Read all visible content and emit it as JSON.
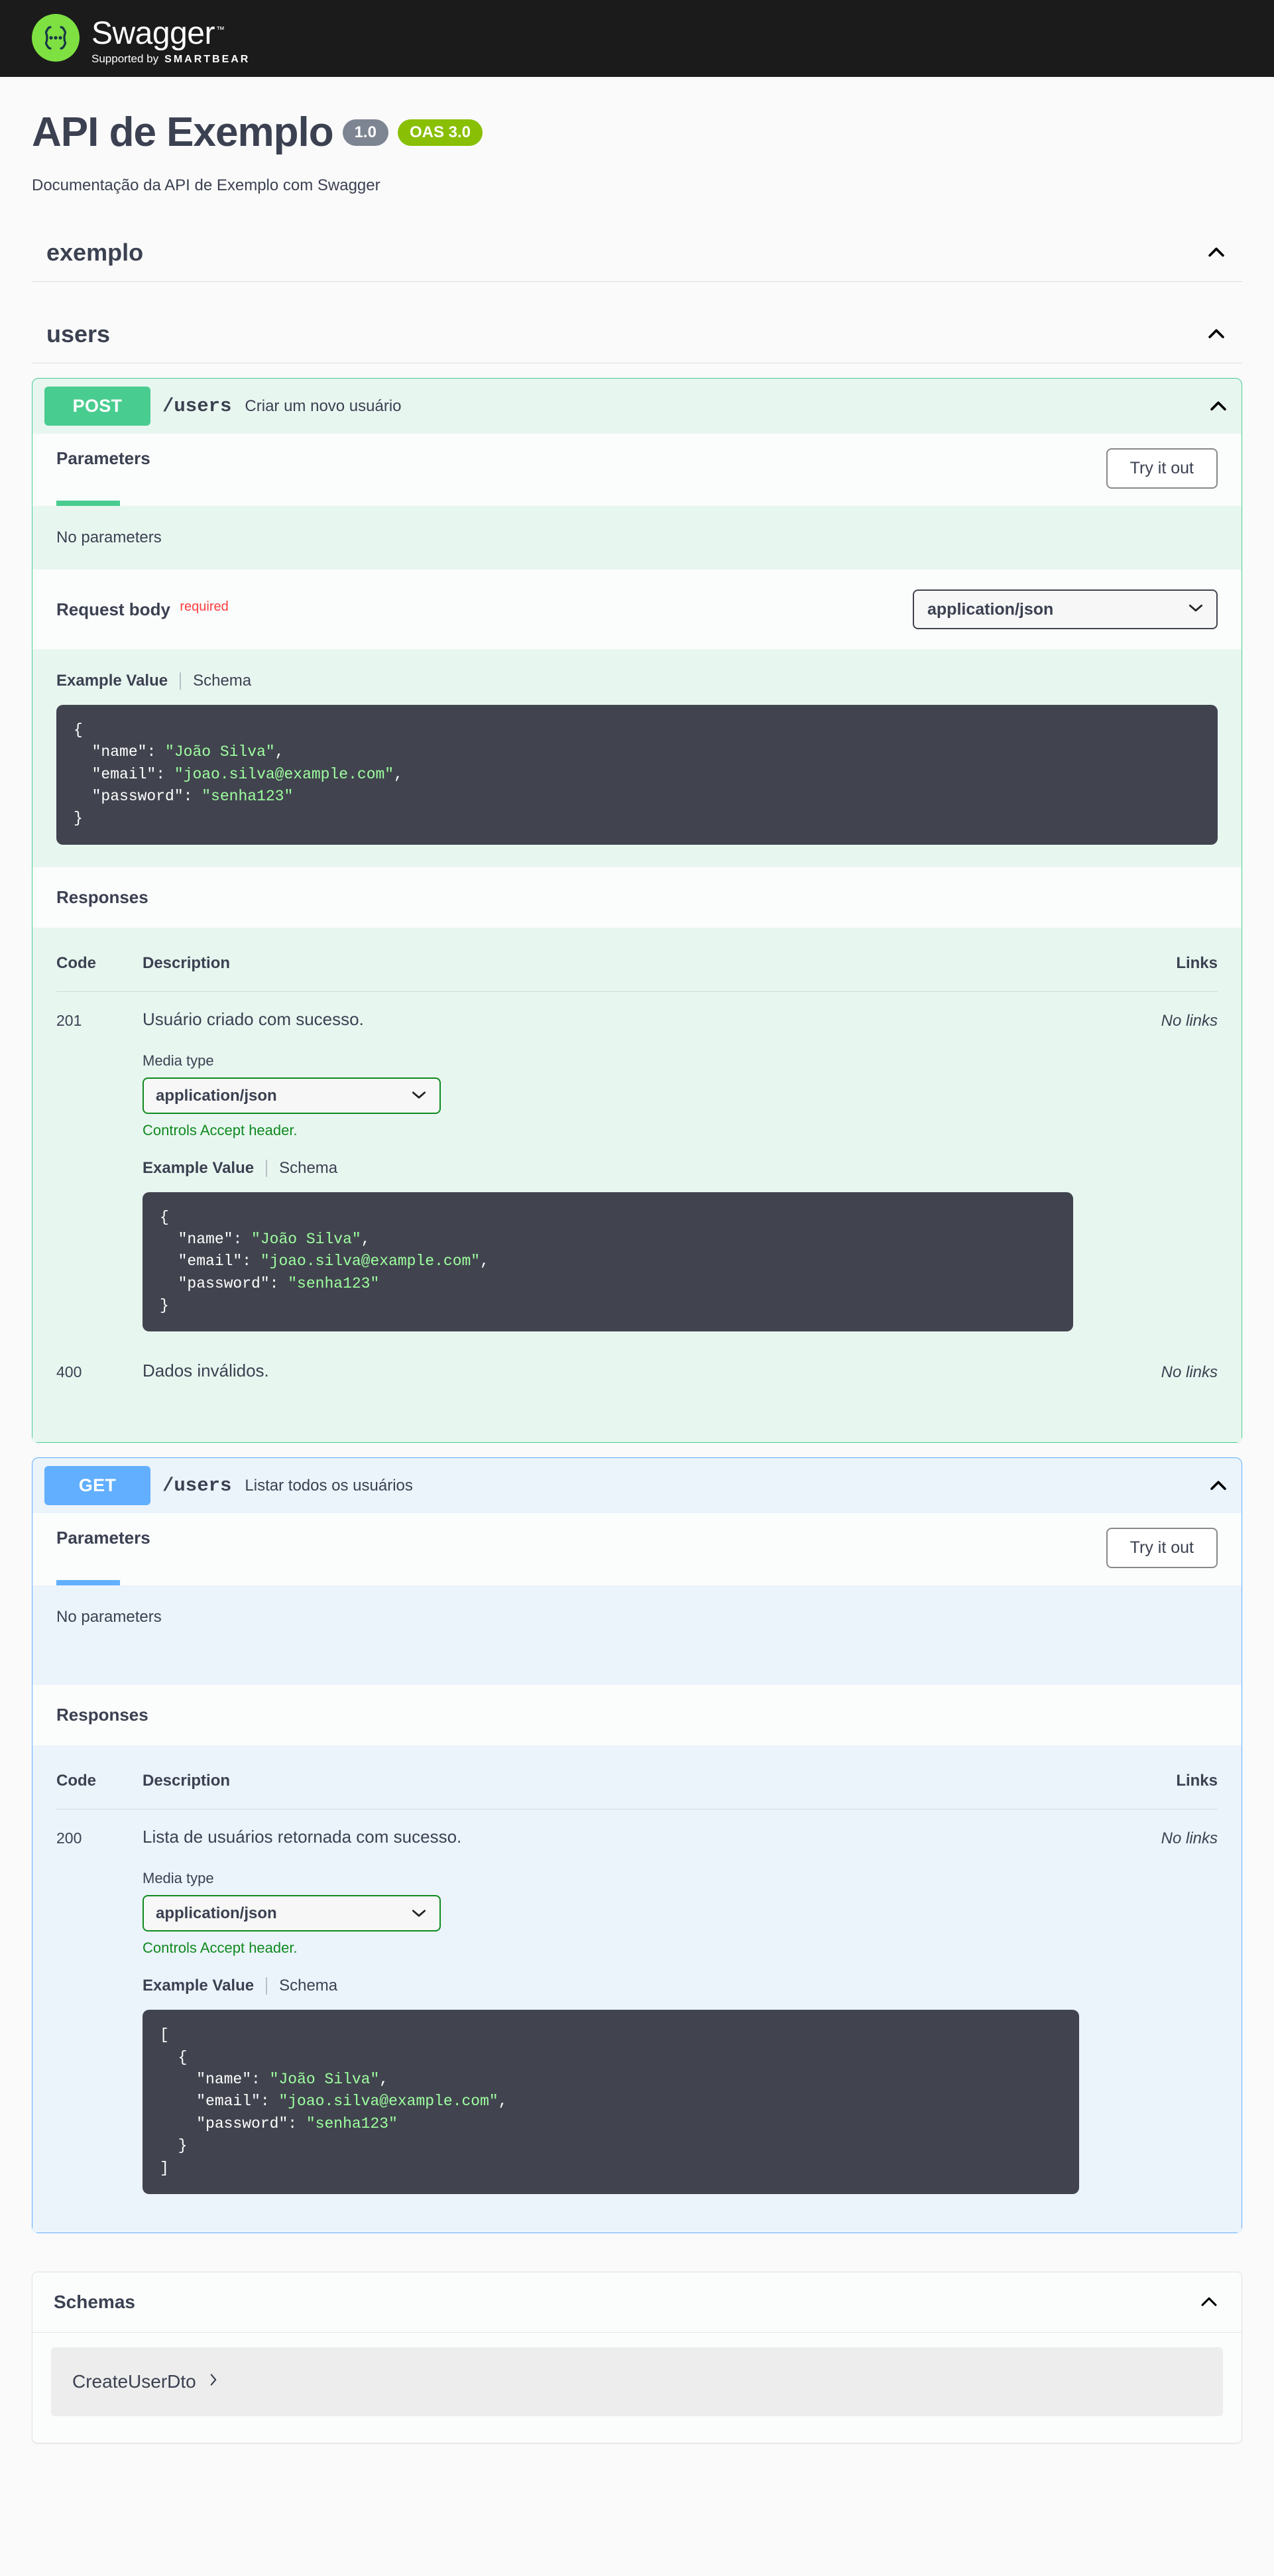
{
  "topbar": {
    "logo_icon": "swagger-braces-icon",
    "brand": "Swagger",
    "trademark": "™",
    "supported_by": "Supported by",
    "company": "SMARTBEAR"
  },
  "info": {
    "title": "API de Exemplo",
    "version_badge": "1.0",
    "oas_badge": "OAS 3.0",
    "description": "Documentação da API de Exemplo com Swagger"
  },
  "tags": [
    {
      "name": "exemplo",
      "collapse_icon": "chevron-up-icon"
    },
    {
      "name": "users",
      "collapse_icon": "chevron-up-icon"
    }
  ],
  "operations": [
    {
      "method": "POST",
      "path": "/users",
      "summary": "Criar um novo usuário",
      "collapse_icon": "chevron-up-icon",
      "parameters_title": "Parameters",
      "try_it_out": "Try it out",
      "no_parameters": "No parameters",
      "request_body": {
        "label": "Request body",
        "required_flag": "required",
        "content_type": "application/json",
        "example_tab": "Example Value",
        "schema_tab": "Schema",
        "example_code": "{\n  \"name\": \"João Silva\",\n  \"email\": \"joao.silva@example.com\",\n  \"password\": \"senha123\"\n}"
      },
      "responses_title": "Responses",
      "table_headers": {
        "code": "Code",
        "description": "Description",
        "links": "Links"
      },
      "responses": [
        {
          "code": "201",
          "description": "Usuário criado com sucesso.",
          "media_type_label": "Media type",
          "media_type": "application/json",
          "accept_note": "Controls Accept header.",
          "example_tab": "Example Value",
          "schema_tab": "Schema",
          "example_code": "{\n  \"name\": \"João Silva\",\n  \"email\": \"joao.silva@example.com\",\n  \"password\": \"senha123\"\n}",
          "links": "No links"
        },
        {
          "code": "400",
          "description": "Dados inválidos.",
          "links": "No links"
        }
      ]
    },
    {
      "method": "GET",
      "path": "/users",
      "summary": "Listar todos os usuários",
      "collapse_icon": "chevron-up-icon",
      "parameters_title": "Parameters",
      "try_it_out": "Try it out",
      "no_parameters": "No parameters",
      "responses_title": "Responses",
      "table_headers": {
        "code": "Code",
        "description": "Description",
        "links": "Links"
      },
      "responses": [
        {
          "code": "200",
          "description": "Lista de usuários retornada com sucesso.",
          "media_type_label": "Media type",
          "media_type": "application/json",
          "accept_note": "Controls Accept header.",
          "example_tab": "Example Value",
          "schema_tab": "Schema",
          "example_code": "[\n  {\n    \"name\": \"João Silva\",\n    \"email\": \"joao.silva@example.com\",\n    \"password\": \"senha123\"\n  }\n]",
          "links": "No links"
        }
      ]
    }
  ],
  "schemas": {
    "title": "Schemas",
    "collapse_icon": "chevron-up-icon",
    "items": [
      {
        "name": "CreateUserDto",
        "expand_icon": "chevron-right-icon"
      }
    ]
  },
  "colors": {
    "post": "#49cc90",
    "get": "#61affe",
    "required": "#f93e3e",
    "accept_note": "#0f8a1f",
    "oas_badge": "#89bf04",
    "version_badge": "#7d8492",
    "code_bg": "#41444e",
    "code_string": "#a5e22d"
  }
}
